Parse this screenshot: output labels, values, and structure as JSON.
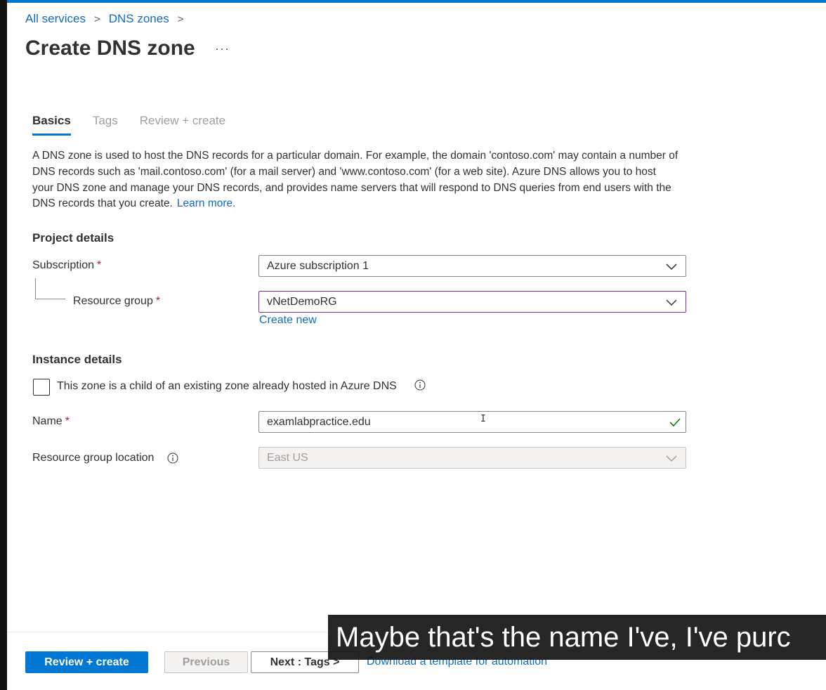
{
  "breadcrumb": {
    "items": [
      "All services",
      "DNS zones"
    ],
    "separator": ">"
  },
  "page": {
    "title": "Create DNS zone",
    "more_glyph": "···"
  },
  "tabs": [
    {
      "label": "Basics",
      "active": true
    },
    {
      "label": "Tags",
      "active": false
    },
    {
      "label": "Review + create",
      "active": false
    }
  ],
  "description": {
    "text": "A DNS zone is used to host the DNS records for a particular domain. For example, the domain 'contoso.com' may contain a number of DNS records such as 'mail.contoso.com' (for a mail server) and 'www.contoso.com' (for a web site). Azure DNS allows you to host your DNS zone and manage your DNS records, and provides name servers that will respond to DNS queries from end users with the DNS records that you create.",
    "link": "Learn more."
  },
  "project_details": {
    "title": "Project details",
    "subscription_label": "Subscription",
    "subscription_value": "Azure subscription 1",
    "resource_group_label": "Resource group",
    "resource_group_value": "vNetDemoRG",
    "create_new": "Create new",
    "required_mark": "*"
  },
  "instance_details": {
    "title": "Instance details",
    "child_zone_label": "This zone is a child of an existing zone already hosted in Azure DNS",
    "child_zone_checked": false,
    "name_label": "Name",
    "name_value": "examlabpractice.edu",
    "location_label": "Resource group location",
    "location_value": "East US"
  },
  "footer": {
    "review_create": "Review + create",
    "previous": "Previous",
    "next": "Next : Tags >",
    "download": "Download a template for automation"
  },
  "caption": "Maybe that's the name I've, I've purc",
  "colors": {
    "accent": "#0078d4",
    "link": "#0f6cbd",
    "required": "#a4262c",
    "focus": "#8a2da5",
    "valid": "#107c10"
  }
}
